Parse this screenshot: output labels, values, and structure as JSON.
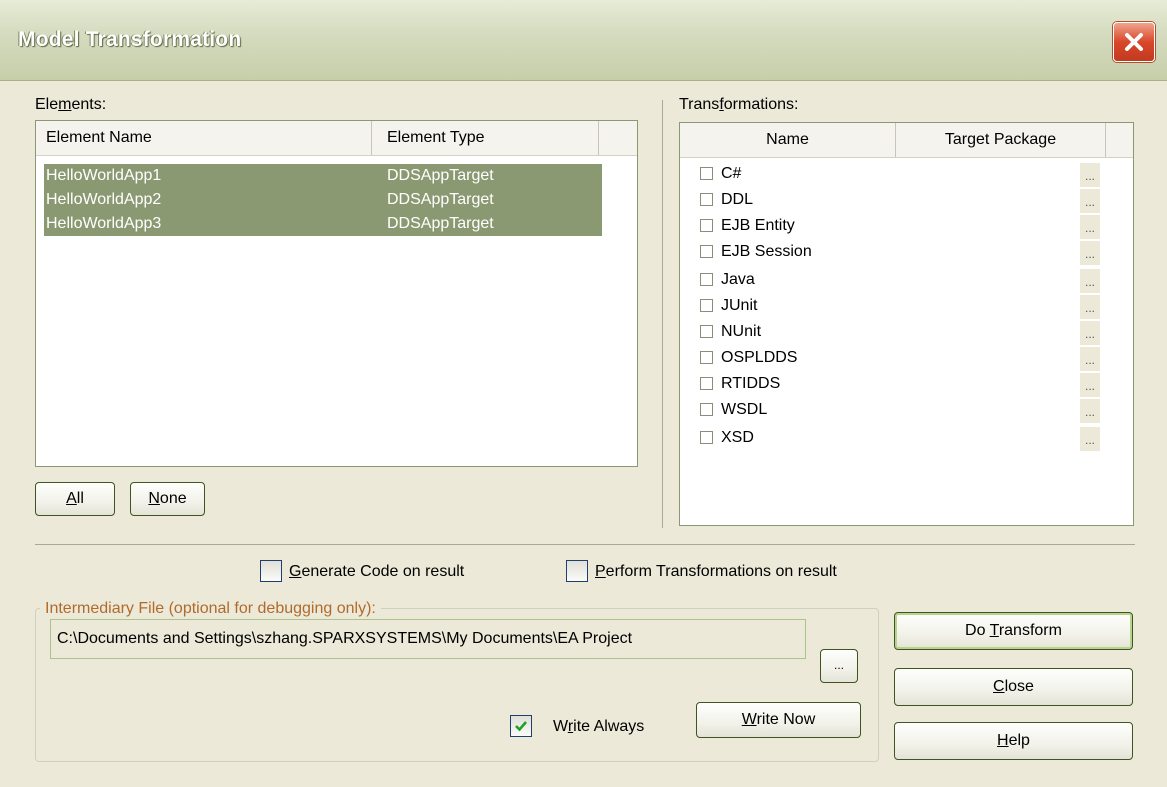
{
  "window": {
    "title": "Model Transformation",
    "close_glyph": "✕"
  },
  "elements": {
    "label": "Elements:",
    "columns": [
      "Element Name",
      "Element Type"
    ],
    "rows": [
      {
        "name": "HelloWorldApp1",
        "type": "DDSAppTarget"
      },
      {
        "name": "HelloWorldApp2",
        "type": "DDSAppTarget"
      },
      {
        "name": "HelloWorldApp3",
        "type": "DDSAppTarget"
      }
    ],
    "all_button": "All",
    "none_button": "None"
  },
  "transformations": {
    "label": "Transformations:",
    "columns": [
      "Name",
      "Target Package"
    ],
    "items": [
      "C#",
      "DDL",
      "EJB Entity",
      "EJB Session",
      "Java",
      "JUnit",
      "NUnit",
      "OSPLDDS",
      "RTIDDS",
      "WSDL",
      "XSD"
    ],
    "dots": "..."
  },
  "options": {
    "generate_code": "Generate Code on result",
    "perform_transformations": "Perform Transformations on result"
  },
  "intermediary": {
    "group_label": "Intermediary File (optional for debugging only):",
    "path": "C:\\Documents and Settings\\szhang.SPARXSYSTEMS\\My Documents\\EA Project",
    "browse": "...",
    "write_always": "Write Always",
    "write_always_checked": true,
    "write_now": "Write Now"
  },
  "buttons": {
    "do_transform": "Do Transform",
    "close": "Close",
    "help": "Help"
  },
  "colors": {
    "selection": "#8a9971",
    "group_label": "#b06b2c",
    "dialog_bg": "#ece9d8"
  }
}
